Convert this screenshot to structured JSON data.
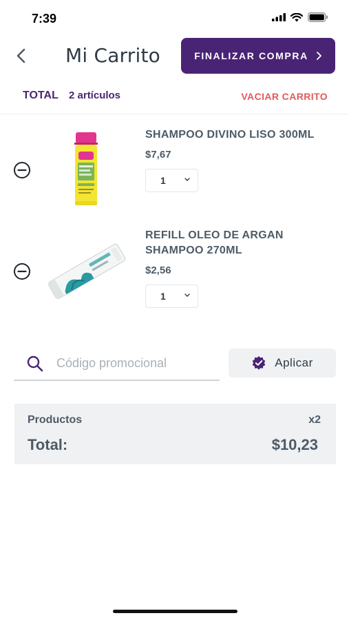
{
  "status_bar": {
    "time": "7:39"
  },
  "header": {
    "title": "Mi Carrito",
    "checkout_label": "FINALIZAR COMPRA",
    "checkout_chevron": "›"
  },
  "summary": {
    "total_label": "TOTAL",
    "item_count": "2 artículos",
    "empty_cart_label": "VACIAR CARRITO"
  },
  "items": [
    {
      "name": "SHAMPOO DIVINO LISO 300ML",
      "price": "$7,67",
      "quantity": "1"
    },
    {
      "name": "REFILL OLEO DE ARGAN SHAMPOO 270ML",
      "price": "$2,56",
      "quantity": "1"
    }
  ],
  "promo": {
    "placeholder": "Código promocional",
    "apply_label": "Aplicar"
  },
  "totals": {
    "products_label": "Productos",
    "products_count": "x2",
    "total_label": "Total:",
    "total_value": "$10,23"
  },
  "colors": {
    "brand_purple": "#4a2474",
    "danger_red": "#e35a5a",
    "text_gray": "#4e5b66",
    "panel_bg": "#eff1f3"
  },
  "icons": [
    "signal-icon",
    "wifi-icon",
    "battery-icon",
    "back-arrow-icon",
    "chevron-right-icon",
    "remove-circle-icon",
    "chevron-down-icon",
    "search-icon",
    "verified-badge-icon"
  ]
}
